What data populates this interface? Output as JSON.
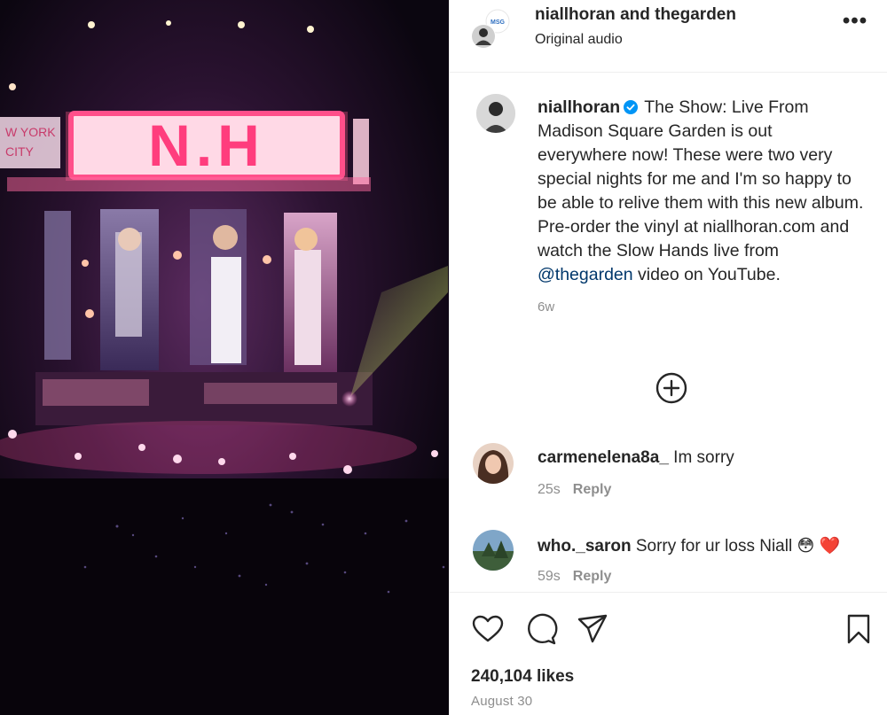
{
  "media": {
    "stage_sign": "N.H",
    "side_sign_line1": "W YORK",
    "side_sign_line2": "CITY"
  },
  "header": {
    "title": "niallhoran and thegarden",
    "audio": "Original audio",
    "more": "•••",
    "collab_badge_text": "MSG"
  },
  "caption": {
    "username": "niallhoran",
    "verified": true,
    "text_before_mention": "The Show: Live From Madison Square Garden is out everywhere now! These were two very special nights for me and I'm so happy to be able to relive them with this new album. Pre-order the vinyl at niallhoran.com and watch the Slow Hands live from",
    "mention": "@thegarden",
    "text_after_mention": "video on YouTube.",
    "time": "6w"
  },
  "load_more_icon": "plus-circle-icon",
  "comments": [
    {
      "username": "carmenelena8a_",
      "text": "Im sorry",
      "time": "25s",
      "reply": "Reply"
    },
    {
      "username": "who._saron",
      "text": "Sorry for ur loss Niall",
      "emojis": "😳 ❤️",
      "time": "59s",
      "reply": "Reply"
    }
  ],
  "actions": {
    "icons": [
      "heart-icon",
      "comment-icon",
      "share-icon",
      "bookmark-icon"
    ],
    "likes": "240,104 likes",
    "date": "August 30"
  },
  "colors": {
    "verified_blue": "#0095f6",
    "mention_blue": "#00376b",
    "muted_gray": "#8e8e8e",
    "heart_red": "#ed1c24"
  }
}
